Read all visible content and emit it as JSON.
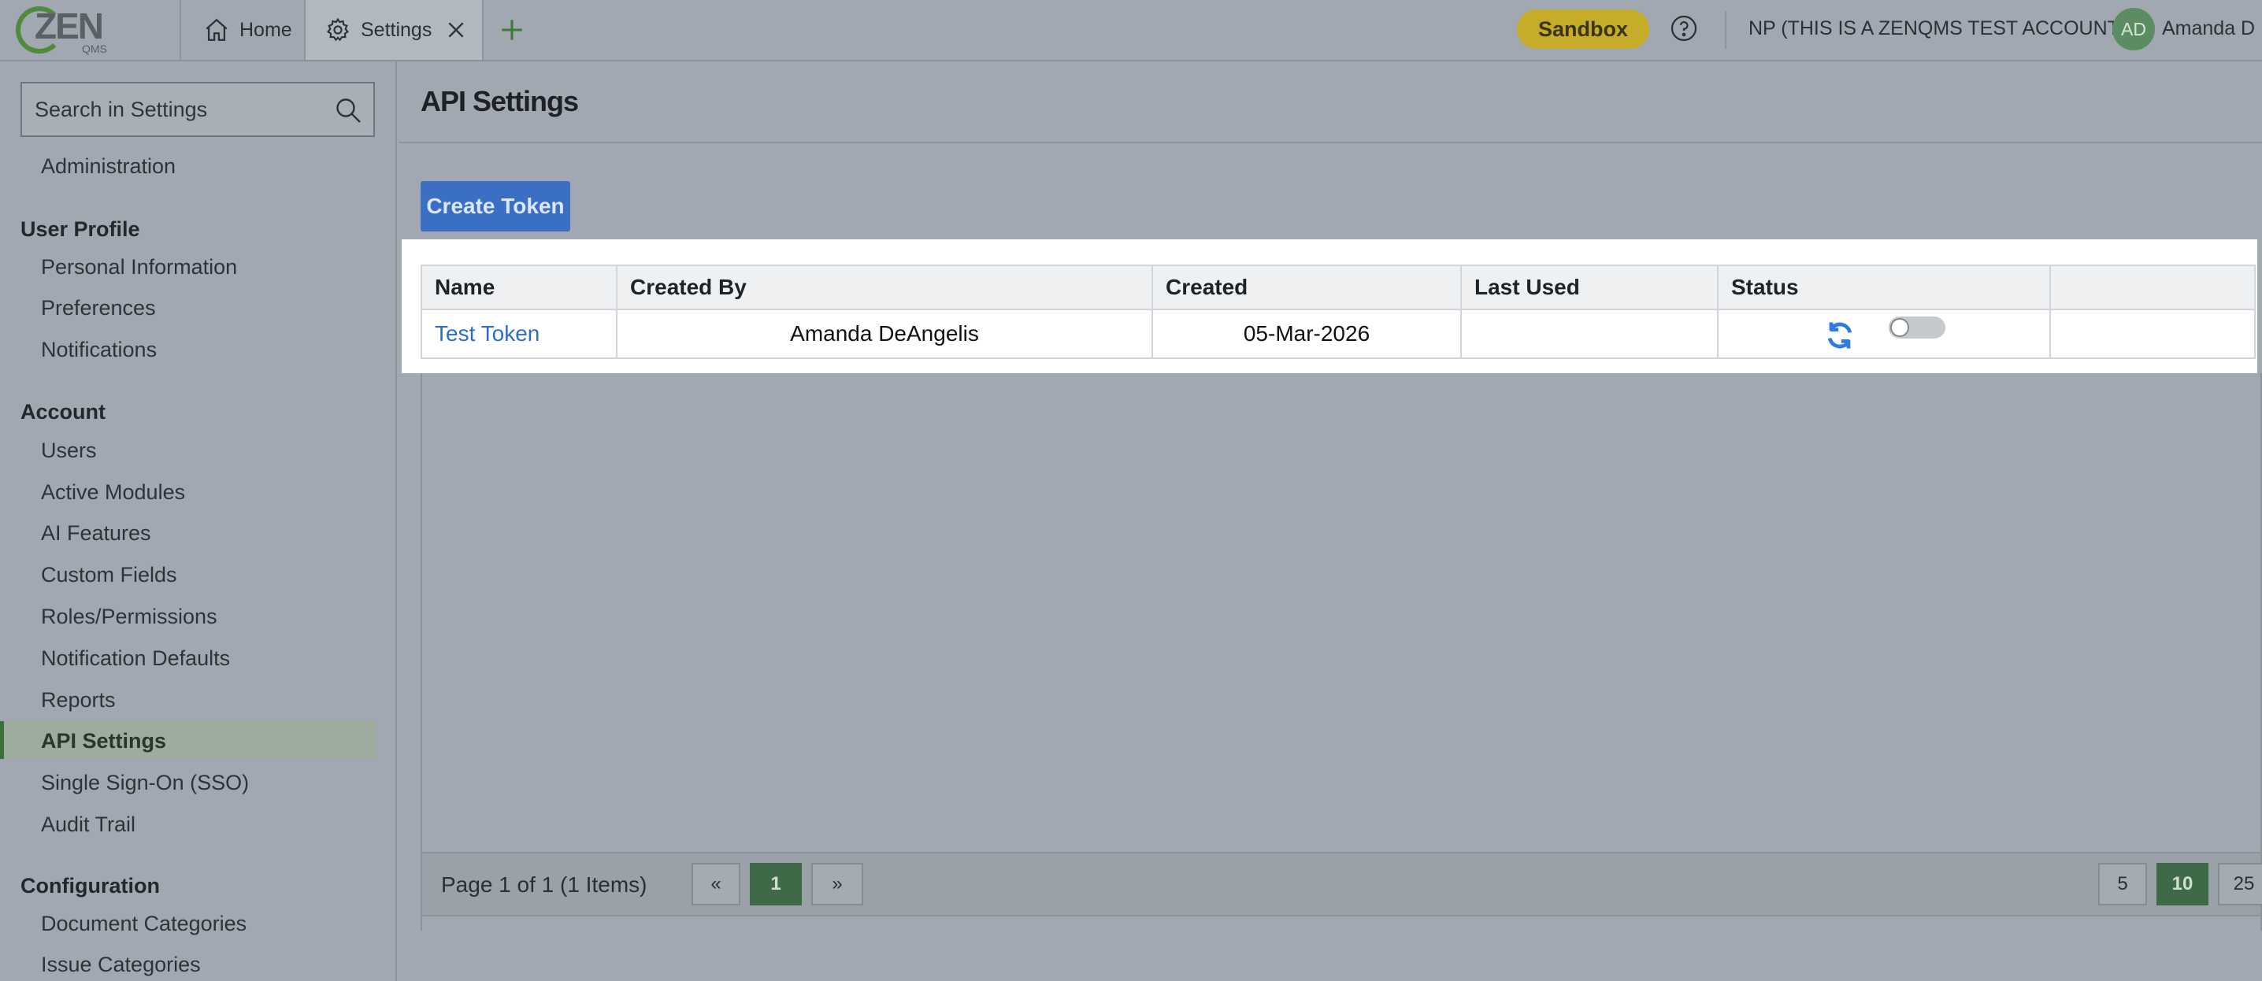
{
  "header": {
    "logo_word": "ZEN",
    "logo_sub": "QMS",
    "tabs": [
      {
        "label": "Home",
        "icon": "home-icon"
      },
      {
        "label": "Settings",
        "icon": "gear-icon"
      }
    ],
    "sandbox_label": "Sandbox",
    "account_name": "NP (THIS IS A ZENQMS TEST ACCOUNT)",
    "avatar_initials": "AD",
    "user_name": "Amanda D"
  },
  "sidebar": {
    "search_placeholder": "Search in Settings",
    "items": {
      "administration": "Administration",
      "user_profile": "User Profile",
      "personal_information": "Personal Information",
      "preferences": "Preferences",
      "notifications": "Notifications",
      "account": "Account",
      "users": "Users",
      "active_modules": "Active Modules",
      "ai_features": "AI Features",
      "custom_fields": "Custom Fields",
      "roles_permissions": "Roles/Permissions",
      "notification_defaults": "Notification Defaults",
      "reports": "Reports",
      "api_settings": "API Settings",
      "sso": "Single Sign-On (SSO)",
      "audit_trail": "Audit Trail",
      "configuration": "Configuration",
      "document_categories": "Document Categories",
      "issue_categories": "Issue Categories"
    },
    "active_item": "API Settings"
  },
  "main": {
    "title": "API Settings",
    "create_button": "Create Token",
    "table": {
      "columns": [
        "Name",
        "Created By",
        "Created",
        "Last Used",
        "Status",
        ""
      ],
      "rows": [
        {
          "name": "Test Token",
          "created_by": "Amanda DeAngelis",
          "created": "05-Mar-2026",
          "last_used": "",
          "status_enabled": false
        }
      ]
    },
    "pager": {
      "info": "Page 1 of 1 (1 Items)",
      "prev": "«",
      "current": "1",
      "next": "»",
      "page_sizes": [
        "5",
        "10",
        "25"
      ],
      "selected_page_size": "10"
    }
  },
  "colors": {
    "accent_green": "#3f6a47",
    "primary_blue": "#3b6fc4",
    "sandbox_yellow": "#c6ac28",
    "link_blue": "#2c6fc1"
  }
}
